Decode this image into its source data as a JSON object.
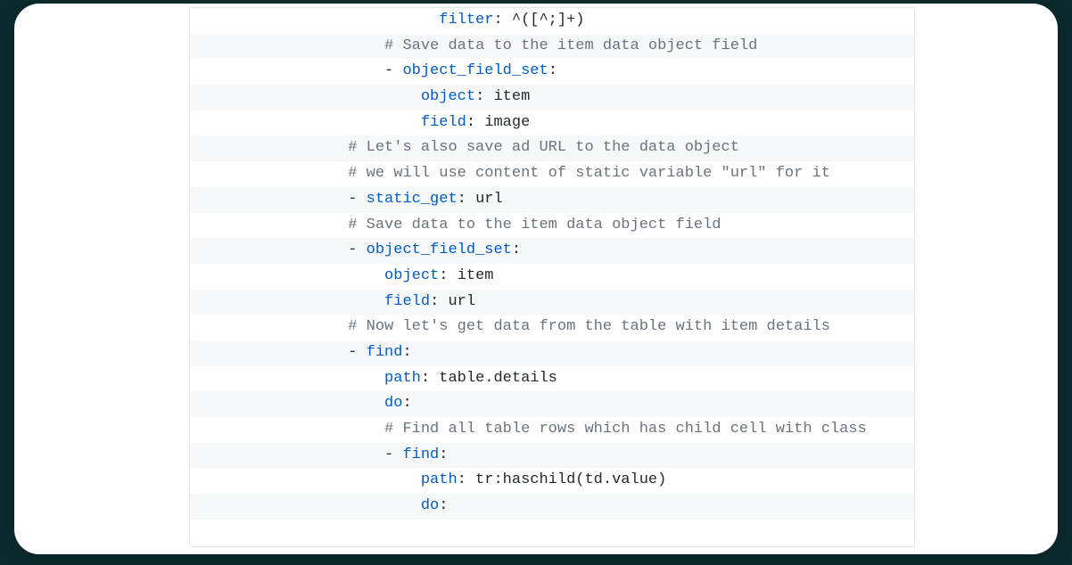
{
  "code": {
    "lines": [
      {
        "indent": 26,
        "alt": false,
        "segments": [
          {
            "cls": "tok-key",
            "text": "filter"
          },
          {
            "cls": "tok-plain",
            "text": ": ^([^;]+)"
          }
        ]
      },
      {
        "indent": 20,
        "alt": true,
        "segments": [
          {
            "cls": "tok-comment",
            "text": "# Save data to the item data object field"
          }
        ]
      },
      {
        "indent": 20,
        "alt": false,
        "segments": [
          {
            "cls": "tok-dash",
            "text": "- "
          },
          {
            "cls": "tok-key",
            "text": "object_field_set"
          },
          {
            "cls": "tok-plain",
            "text": ":"
          }
        ]
      },
      {
        "indent": 24,
        "alt": true,
        "segments": [
          {
            "cls": "tok-key",
            "text": "object"
          },
          {
            "cls": "tok-plain",
            "text": ": item"
          }
        ]
      },
      {
        "indent": 24,
        "alt": false,
        "segments": [
          {
            "cls": "tok-key",
            "text": "field"
          },
          {
            "cls": "tok-plain",
            "text": ": image"
          }
        ]
      },
      {
        "indent": 16,
        "alt": true,
        "segments": [
          {
            "cls": "tok-comment",
            "text": "# Let's also save ad URL to the data object"
          }
        ]
      },
      {
        "indent": 16,
        "alt": false,
        "segments": [
          {
            "cls": "tok-comment",
            "text": "# we will use content of static variable \"url\" for it"
          }
        ]
      },
      {
        "indent": 16,
        "alt": true,
        "segments": [
          {
            "cls": "tok-dash",
            "text": "- "
          },
          {
            "cls": "tok-key",
            "text": "static_get"
          },
          {
            "cls": "tok-plain",
            "text": ": url"
          }
        ]
      },
      {
        "indent": 16,
        "alt": false,
        "segments": [
          {
            "cls": "tok-comment",
            "text": "# Save data to the item data object field"
          }
        ]
      },
      {
        "indent": 16,
        "alt": true,
        "segments": [
          {
            "cls": "tok-dash",
            "text": "- "
          },
          {
            "cls": "tok-key",
            "text": "object_field_set"
          },
          {
            "cls": "tok-plain",
            "text": ":"
          }
        ]
      },
      {
        "indent": 20,
        "alt": false,
        "segments": [
          {
            "cls": "tok-key",
            "text": "object"
          },
          {
            "cls": "tok-plain",
            "text": ": item"
          }
        ]
      },
      {
        "indent": 20,
        "alt": true,
        "segments": [
          {
            "cls": "tok-key",
            "text": "field"
          },
          {
            "cls": "tok-plain",
            "text": ": url"
          }
        ]
      },
      {
        "indent": 16,
        "alt": false,
        "segments": [
          {
            "cls": "tok-comment",
            "text": "# Now let's get data from the table with item details"
          }
        ]
      },
      {
        "indent": 16,
        "alt": true,
        "segments": [
          {
            "cls": "tok-dash",
            "text": "- "
          },
          {
            "cls": "tok-key",
            "text": "find"
          },
          {
            "cls": "tok-plain",
            "text": ":"
          }
        ]
      },
      {
        "indent": 20,
        "alt": false,
        "segments": [
          {
            "cls": "tok-key",
            "text": "path"
          },
          {
            "cls": "tok-plain",
            "text": ": table.details"
          }
        ]
      },
      {
        "indent": 20,
        "alt": true,
        "segments": [
          {
            "cls": "tok-key",
            "text": "do"
          },
          {
            "cls": "tok-plain",
            "text": ":"
          }
        ]
      },
      {
        "indent": 20,
        "alt": false,
        "segments": [
          {
            "cls": "tok-comment",
            "text": "# Find all table rows which has child cell with class"
          }
        ]
      },
      {
        "indent": 20,
        "alt": true,
        "segments": [
          {
            "cls": "tok-dash",
            "text": "- "
          },
          {
            "cls": "tok-key",
            "text": "find"
          },
          {
            "cls": "tok-plain",
            "text": ":"
          }
        ]
      },
      {
        "indent": 24,
        "alt": false,
        "segments": [
          {
            "cls": "tok-key",
            "text": "path"
          },
          {
            "cls": "tok-plain",
            "text": ": tr:haschild(td.value)"
          }
        ]
      },
      {
        "indent": 24,
        "alt": true,
        "segments": [
          {
            "cls": "tok-key",
            "text": "do"
          },
          {
            "cls": "tok-plain",
            "text": ":"
          }
        ]
      }
    ]
  }
}
